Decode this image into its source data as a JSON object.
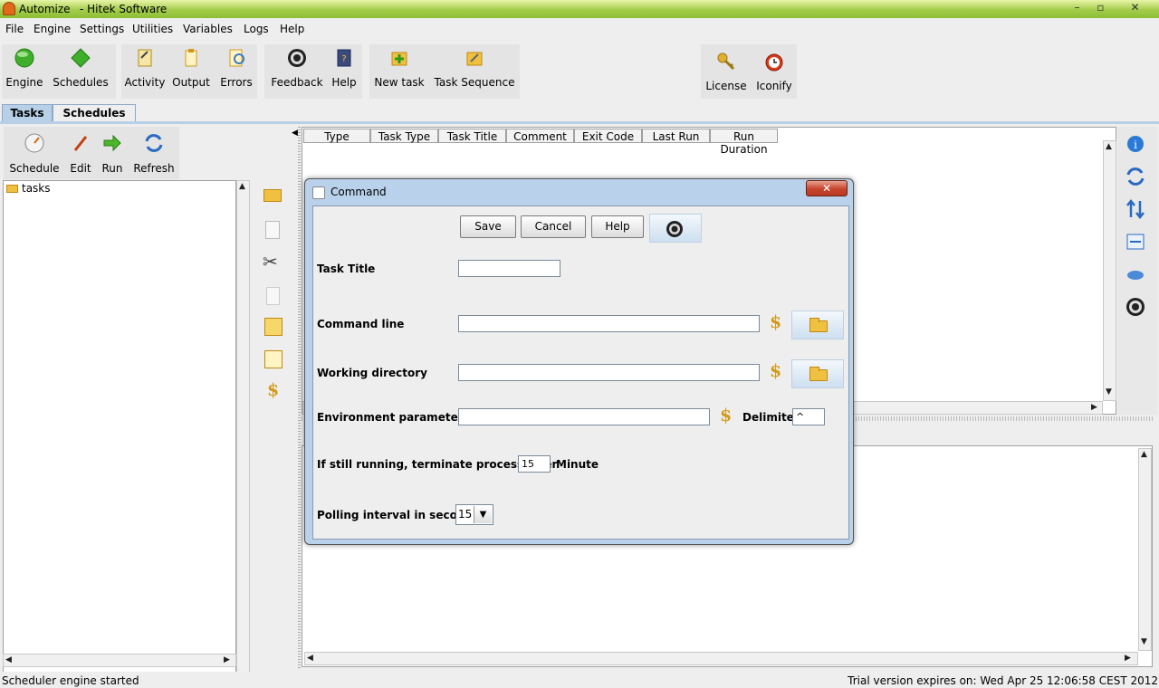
{
  "window": {
    "app_name": "Automize",
    "publisher": "- Hitek Software",
    "min": "–",
    "max": "▫",
    "close": "✕"
  },
  "menu": [
    {
      "label": "File"
    },
    {
      "label": "Engine"
    },
    {
      "label": "Settings"
    },
    {
      "label": "Utilities"
    },
    {
      "label": "Variables"
    },
    {
      "label": "Logs"
    },
    {
      "label": "Help"
    }
  ],
  "toolbar": {
    "engine": "Engine",
    "schedules": "Schedules",
    "activity": "Activity",
    "output": "Output",
    "errors": "Errors",
    "feedback": "Feedback",
    "help": "Help",
    "new_task": "New task",
    "task_sequence": "Task Sequence",
    "license": "License",
    "iconify": "Iconify"
  },
  "tabs": {
    "tasks": "Tasks",
    "schedules": "Schedules"
  },
  "left_toolbar": {
    "schedule": "Schedule",
    "edit": "Edit",
    "run": "Run",
    "refresh": "Refresh"
  },
  "tree": {
    "root": "tasks"
  },
  "table": {
    "columns": [
      "Type",
      "Task Type",
      "Task Title",
      "Comment",
      "Exit Code",
      "Last Run",
      "Run Duration"
    ]
  },
  "dialog": {
    "title": "Command",
    "save": "Save",
    "cancel": "Cancel",
    "help": "Help",
    "task_title_label": "Task Title",
    "task_title_value": "",
    "command_line_label": "Command line",
    "command_line_value": "",
    "working_dir_label": "Working directory",
    "working_dir_value": "",
    "env_params_label": "Environment parameters",
    "env_params_value": "",
    "delimiter_label": "Delimiter",
    "delimiter_value": "^",
    "terminate_label": "If still running, terminate process after",
    "terminate_value": "15",
    "terminate_unit": "Minute",
    "polling_label": "Polling interval in seconds",
    "polling_value": "15",
    "dollar": "$"
  },
  "status": {
    "left": "Scheduler engine started",
    "right": "Trial version expires on: Wed Apr 25 12:06:58 CEST 2012"
  },
  "colors": {
    "title_bar": "#a3cc4a",
    "tab_selected": "#b8cfe8",
    "dialog_frame": "#b9d1ea",
    "close_red": "#c8442c",
    "dollar": "#d29a1a"
  }
}
